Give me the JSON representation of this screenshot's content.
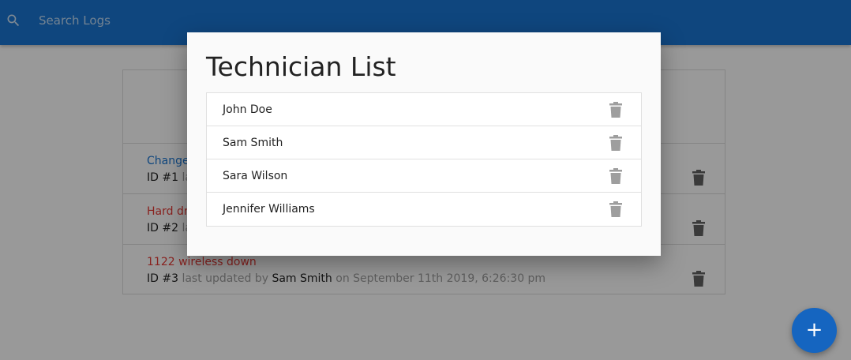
{
  "search": {
    "placeholder": "Search Logs",
    "icon": "search-icon"
  },
  "logs": [
    {
      "title": "Change",
      "status": "normal",
      "id_label": "ID #1",
      "prefix": "la",
      "updated_by_label": "",
      "tech": "",
      "date_label": ""
    },
    {
      "title": "Hard dr",
      "status": "attention",
      "id_label": "ID #2",
      "prefix": "la",
      "updated_by_label": "",
      "tech": "",
      "date_label": ""
    },
    {
      "title": "1122 wireless down",
      "status": "attention",
      "id_label": "ID #3",
      "prefix": "last updated by",
      "tech": "Sam Smith",
      "date_label": "on September 11th 2019, 6:26:30 pm"
    }
  ],
  "modal": {
    "title": "Technician List",
    "technicians": [
      {
        "name": "John Doe"
      },
      {
        "name": "Sam Smith"
      },
      {
        "name": "Sara Wilson"
      },
      {
        "name": "Jennifer Williams"
      }
    ]
  },
  "fab": {
    "label": "+",
    "icon": "plus-icon"
  },
  "colors": {
    "primary": "#1976d2",
    "attention": "#e53935",
    "fab": "#1565c0"
  }
}
